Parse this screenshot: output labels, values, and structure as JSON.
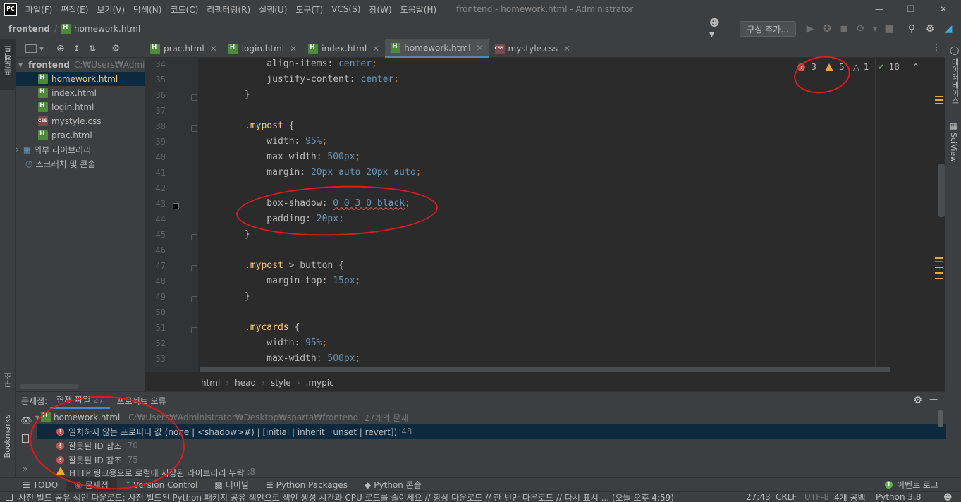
{
  "titlebar": {
    "app_logo": "PC",
    "menu": [
      "파일(F)",
      "편집(E)",
      "보기(V)",
      "탐색(N)",
      "코드(C)",
      "리팩터링(R)",
      "실행(U)",
      "도구(T)",
      "VCS(S)",
      "창(W)",
      "도움말(H)"
    ],
    "window_title": "frontend - homework.html - Administrator"
  },
  "navbar": {
    "project": "frontend",
    "file": "homework.html",
    "config_button": "구성 추가..."
  },
  "left_strip": {
    "project_label": "프로젝트",
    "structure_label": "구조",
    "bookmarks_label": "Bookmarks"
  },
  "project_tree": {
    "root": "frontend",
    "root_path": "C:₩Users₩Admin",
    "files": [
      "homework.html",
      "index.html",
      "login.html",
      "mystyle.css",
      "prac.html"
    ],
    "external_libs": "외부 라이브러리",
    "scratches": "스크래치 및 콘솔"
  },
  "tabs": [
    {
      "label": "prac.html",
      "type": "html"
    },
    {
      "label": "login.html",
      "type": "html"
    },
    {
      "label": "index.html",
      "type": "html"
    },
    {
      "label": "homework.html",
      "type": "html",
      "active": true
    },
    {
      "label": "mystyle.css",
      "type": "css"
    }
  ],
  "inspection": {
    "errors": "3",
    "warnings": "5",
    "weak_warnings": "1",
    "ok": "18"
  },
  "right_strip": {
    "database_label": "데이터베이스",
    "sciview_label": "SciView"
  },
  "editor": {
    "line_numbers": [
      "34",
      "35",
      "36",
      "37",
      "38",
      "39",
      "40",
      "41",
      "42",
      "43",
      "44",
      "45",
      "46",
      "47",
      "48",
      "49",
      "50",
      "51",
      "52",
      "53"
    ],
    "lines": [
      [
        "align-items",
        "center"
      ],
      [
        "justify-content",
        "center"
      ],
      [
        "}"
      ],
      [
        ""
      ],
      [
        ".mypost {"
      ],
      [
        "width",
        "95%"
      ],
      [
        "max-width",
        "500px"
      ],
      [
        "margin",
        "20px auto 20px auto"
      ],
      [
        ""
      ],
      [
        "box-shadow",
        "0 0 3 0 black"
      ],
      [
        "padding",
        "20px"
      ],
      [
        "}"
      ],
      [
        ""
      ],
      [
        ".mypost > button {"
      ],
      [
        "margin-top",
        "15px"
      ],
      [
        "}"
      ],
      [
        ""
      ],
      [
        ".mycards {"
      ],
      [
        "width",
        "95%"
      ],
      [
        "max-width",
        "500px"
      ]
    ]
  },
  "breadcrumb": [
    "html",
    "head",
    "style",
    ".mypic"
  ],
  "problems": {
    "title": "문제점:",
    "tabs": [
      "현재 파일",
      "27",
      "프로젝트 오류"
    ],
    "file": "homework.html",
    "file_path": "C:₩Users₩Administrator₩Desktop₩sparta₩frontend",
    "file_count": "27개의 문제",
    "items": [
      {
        "kind": "error",
        "text": "일치하지 않는 프로퍼티 값 (none | <shadow>#) | [initial | inherit | unset | revert])",
        "line": ":43"
      },
      {
        "kind": "error",
        "text": "잘못된 ID 참조",
        "line": ":70"
      },
      {
        "kind": "error",
        "text": "잘못된 ID 참조",
        "line": ":75"
      },
      {
        "kind": "warn",
        "text": "HTTP 링크용으로 로컬에 저장된 라이브러리 누락",
        "line": ":8"
      }
    ]
  },
  "tooltabs": [
    "TODO",
    "문제점",
    "Version Control",
    "터미널",
    "Python Packages",
    "Python 콘솔"
  ],
  "event_log": "이벤트 로그",
  "event_count": "1",
  "statusbar": {
    "message": "사전 빌드 공유 색인 다운로드: 사전 빌드된 Python 패키지 공유 색인으로 색인 생성 시간과 CPU 로드를 줄이세요 // 항상 다운로드 // 한 번만 다운로드 // 다시 표시 ... (오늘 오후 4:59)",
    "position": "27:43",
    "line_sep": "CRLF",
    "encoding": "UTF-8",
    "indent": "4개 공백",
    "interpreter": "Python 3.8"
  },
  "colors": {
    "annotation_red": "#e0191e",
    "accent": "#4a88c7",
    "error": "#c75450",
    "warning": "#f0a732"
  }
}
